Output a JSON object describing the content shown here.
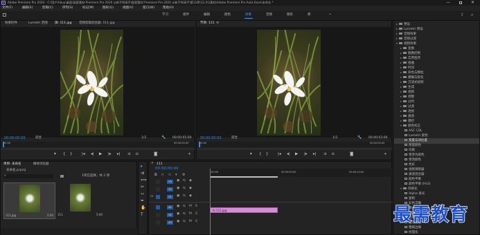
{
  "app": {
    "title": "Adobe Premiere Pro 2020 - C:\\用户\\hbuy\\桌面\\配套素材 Premiere Pro 2020 从新手到高手\\配套素材 Premiere Pro 2020 从新手到高手\\第12章\\12.4\\1素材\\Adobe Premiere Pro Auto-Save\\未命名 *",
    "logo": "Pr"
  },
  "menu": [
    "文件(F)",
    "编辑(E)",
    "剪辑(C)",
    "序列(S)",
    "标记(M)",
    "图形(G)",
    "视图(V)",
    "窗口(W)",
    "帮助(H)"
  ],
  "workspaces": [
    "学习",
    "组件",
    "编辑",
    "颜色",
    "效果",
    "音频",
    "图形",
    "库"
  ],
  "active_workspace": "效果",
  "source_panel": {
    "tabs": [
      "效果控件",
      "Lumetri 范围",
      "源: 111.jpg",
      "音频剪辑混合器: 111.jpg"
    ],
    "timecode": "00:00:00:00",
    "fit": "适合",
    "ratio": "1/2",
    "duration": "00:00:05:00",
    "ruler": [
      "00:00",
      "00:00:05:00"
    ]
  },
  "program_panel": {
    "tab": "节目: 111",
    "timecode": "00:00:00:00",
    "fit": "适合",
    "ratio": "1/2",
    "duration": "00:00:03:00",
    "ruler": [
      "00:00",
      "00:00:05:00"
    ]
  },
  "project_panel": {
    "tabs": [
      "项目: 未命名",
      "媒体浏览器"
    ],
    "project_file": "未命名.prproj",
    "selection_info": "1项已选择，共 2 项",
    "items": [
      {
        "name": "111.jpg",
        "duration": "5:00"
      },
      {
        "name": "111",
        "duration": "5:00"
      }
    ]
  },
  "timeline_panel": {
    "tab": "111",
    "timecode": "00:00:00:00",
    "ruler": [
      ":00:00",
      "00:00:05:00",
      "00:00:10:00"
    ],
    "video_tracks": [
      "V3",
      "V2",
      "V1"
    ],
    "audio_tracks": [
      "A1",
      "A2",
      "A3"
    ],
    "clip": {
      "label": "fx 111.jpg",
      "color": "#d58bd6"
    }
  },
  "effects_panel": {
    "items": [
      {
        "label": "预设",
        "type": "folder",
        "depth": 0,
        "open": false
      },
      {
        "label": "Lumetri 预设",
        "type": "folder",
        "depth": 0,
        "open": false
      },
      {
        "label": "音频效果",
        "type": "folder",
        "depth": 0,
        "open": false
      },
      {
        "label": "音频过渡",
        "type": "folder",
        "depth": 0,
        "open": false
      },
      {
        "label": "视频效果",
        "type": "folder",
        "depth": 0,
        "open": true
      },
      {
        "label": "变换",
        "type": "folder",
        "depth": 1,
        "open": false
      },
      {
        "label": "图像控制",
        "type": "folder",
        "depth": 1,
        "open": false
      },
      {
        "label": "实用程序",
        "type": "folder",
        "depth": 1,
        "open": false
      },
      {
        "label": "扭曲",
        "type": "folder",
        "depth": 1,
        "open": false
      },
      {
        "label": "时间",
        "type": "folder",
        "depth": 1,
        "open": false
      },
      {
        "label": "杂色与颗粒",
        "type": "folder",
        "depth": 1,
        "open": false
      },
      {
        "label": "模糊与锐化",
        "type": "folder",
        "depth": 1,
        "open": false
      },
      {
        "label": "沉浸式视频",
        "type": "folder",
        "depth": 1,
        "open": false
      },
      {
        "label": "生成",
        "type": "folder",
        "depth": 1,
        "open": false
      },
      {
        "label": "视频",
        "type": "folder",
        "depth": 1,
        "open": false
      },
      {
        "label": "调整",
        "type": "folder",
        "depth": 1,
        "open": false
      },
      {
        "label": "过时",
        "type": "folder",
        "depth": 1,
        "open": false
      },
      {
        "label": "过渡",
        "type": "folder",
        "depth": 1,
        "open": false
      },
      {
        "label": "透视",
        "type": "folder",
        "depth": 1,
        "open": false
      },
      {
        "label": "通道",
        "type": "folder",
        "depth": 1,
        "open": false
      },
      {
        "label": "键控",
        "type": "folder",
        "depth": 1,
        "open": false
      },
      {
        "label": "颜色校正",
        "type": "folder",
        "depth": 1,
        "open": true
      },
      {
        "label": "ASC CDL",
        "type": "fx",
        "depth": 2
      },
      {
        "label": "Lumetri 颜色",
        "type": "fx",
        "depth": 2
      },
      {
        "label": "亮度与对比度",
        "type": "fx",
        "depth": 2,
        "selected": true
      },
      {
        "label": "保留颜色",
        "type": "fx",
        "depth": 2
      },
      {
        "label": "均衡",
        "type": "fx",
        "depth": 2
      },
      {
        "label": "更改为颜色",
        "type": "fx",
        "depth": 2
      },
      {
        "label": "更改颜色",
        "type": "fx",
        "depth": 2
      },
      {
        "label": "色彩",
        "type": "fx",
        "depth": 2
      },
      {
        "label": "视频限制器",
        "type": "fx",
        "depth": 2
      },
      {
        "label": "通道混合器",
        "type": "fx",
        "depth": 2
      },
      {
        "label": "颜色平衡",
        "type": "fx",
        "depth": 2
      },
      {
        "label": "颜色平衡 (HLS)",
        "type": "fx",
        "depth": 2
      },
      {
        "label": "风格化",
        "type": "folder",
        "depth": 1,
        "open": true
      },
      {
        "label": "Alpha 发光",
        "type": "fx",
        "depth": 2
      },
      {
        "label": "复制",
        "type": "fx",
        "depth": 2
      },
      {
        "label": "彩色浮雕",
        "type": "fx",
        "depth": 2
      },
      {
        "label": "曝光过度",
        "type": "fx",
        "depth": 2
      },
      {
        "label": "查找边缘",
        "type": "fx",
        "depth": 2
      },
      {
        "label": "浮雕",
        "type": "fx",
        "depth": 2
      },
      {
        "label": "画笔描边",
        "type": "fx",
        "depth": 2
      },
      {
        "label": "粗糙边缘",
        "type": "fx",
        "depth": 2
      },
      {
        "label": "纹理化",
        "type": "fx",
        "depth": 2
      }
    ]
  },
  "watermark": "最需教育"
}
